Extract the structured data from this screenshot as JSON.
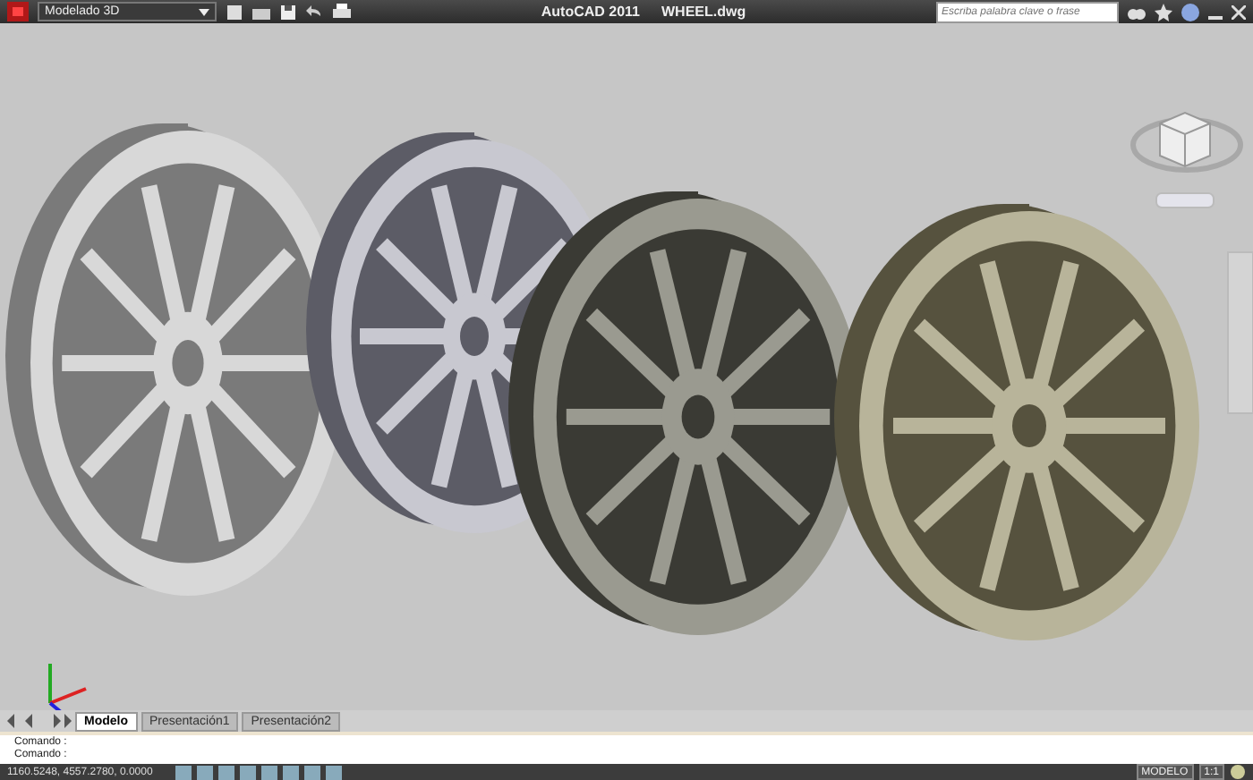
{
  "title_bar": {
    "workspace": "Modelado 3D",
    "app_title": "AutoCAD 2011",
    "file_name": "WHEEL.dwg",
    "search": {
      "placeholder": "Escriba palabra clave o frase"
    }
  },
  "layout_tabs": [
    {
      "label": "Modelo",
      "selected": true
    },
    {
      "label": "Presentación1",
      "selected": false
    },
    {
      "label": "Presentación2",
      "selected": false
    }
  ],
  "command_lines": [
    "Comando :",
    "Comando :"
  ],
  "status_bar": {
    "coordinates": "1160.5248, 4557.2780, 0.0000",
    "space": "MODELO",
    "scale": "1:1"
  }
}
